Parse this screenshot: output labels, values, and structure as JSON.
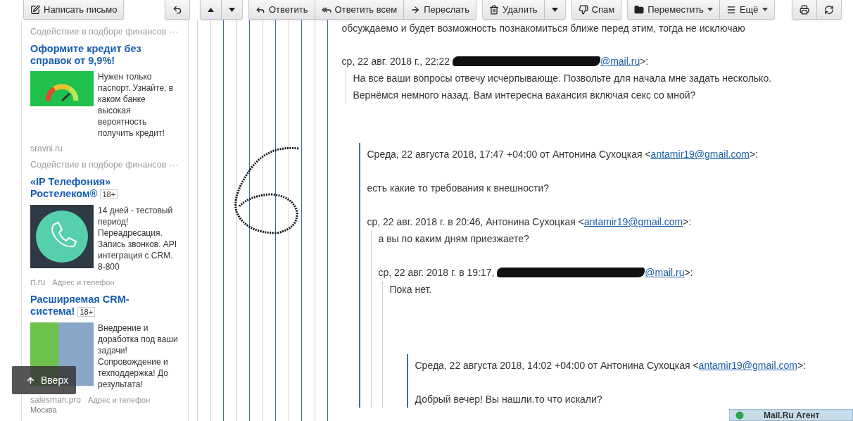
{
  "toolbar": {
    "groups": [
      [
        {
          "kind": "compose",
          "label": "Написать письмо"
        }
      ],
      [
        {
          "kind": "undo"
        }
      ],
      [
        {
          "kind": "up"
        },
        {
          "kind": "down"
        }
      ],
      [
        {
          "kind": "reply",
          "label": "Ответить"
        },
        {
          "kind": "reply-all",
          "label": "Ответить всем"
        },
        {
          "kind": "forward",
          "label": "Переслать"
        }
      ],
      [
        {
          "kind": "delete",
          "label": "Удалить"
        },
        {
          "kind": "caret"
        }
      ],
      [
        {
          "kind": "spam",
          "label": "Спам"
        }
      ],
      [
        {
          "kind": "move",
          "label": "Переместить",
          "dropdown": true
        },
        {
          "kind": "more",
          "label": "Ещё",
          "dropdown": true
        }
      ],
      [
        {
          "kind": "print"
        },
        {
          "kind": "refresh"
        }
      ]
    ]
  },
  "sidebar": {
    "ads": [
      {
        "category": "Содействие в подборе финансов",
        "title": "Оформите кредит без справок от 9,9%!",
        "text": "Нужен только паспорт. Узнайте, в каком банке высокая вероятность получить кредит!",
        "domain": "sravni.ru"
      },
      {
        "category": "Содействие в подборе финансов",
        "title": "«IP Телефония» Ростелеком®",
        "badge": "18+",
        "text": "14 дней - тестовый период! Переадресация. Запись звонков. API интеграция с CRM. 8-800",
        "domain": "rt.ru",
        "address_link": "Адрес и телефон"
      },
      {
        "title": "Расширяемая CRM-система!",
        "badge": "18+",
        "text": "Внедрение и доработка под ваши задачи! Сопровождение и техподдержка! До результата!",
        "domain": "salesman.pro",
        "address_link": "Адрес и телефон",
        "city": "Москва"
      }
    ],
    "more_marker": "···",
    "scroll_top_button": "Вверх"
  },
  "letter": {
    "earlier_text": "обсуждаемо и будет возможность познакомиться ближе перед этим, тогда не исключаю",
    "messages": [
      {
        "kind": "gmail",
        "header": "ср, 22 авг. 2018 г., 22:22 ",
        "redacted": true,
        "email": "@mail.ru",
        "tail": ">:",
        "body": [
          "На все ваши вопросы отвечу исчерпывающе. Позвольте для начала мне задать несколько.",
          "Вернёмся немного назад. Вам интересна вакансия включая секс со мной?"
        ]
      },
      {
        "kind": "mailru",
        "header": "Среда, 22 августа 2018, 17:47 +04:00 от Антонина Сухоцкая <",
        "redacted": false,
        "email": "antamir19@gmail.com",
        "tail": ">:",
        "body": [
          "есть какие то требования к внешности?"
        ],
        "children": [
          {
            "kind": "gmail",
            "header": "ср, 22 авг. 2018 г. в 20:46, Антонина Сухоцкая <",
            "redacted": false,
            "email": "antamir19@gmail.com",
            "tail": ">:",
            "body": [
              "а вы по каким дням приезжаете?"
            ],
            "children": [
              {
                "kind": "gmail",
                "header": "ср, 22 авг. 2018 г. в 19:17, ",
                "redacted": true,
                "email": "@mail.ru",
                "tail": ">:",
                "body": [
                  "Пока нет."
                ],
                "children": [
                  {
                    "kind": "mailru",
                    "header": "Среда, 22 августа 2018, 14:02 +04:00 от Антонина Сухоцкая <",
                    "redacted": false,
                    "email": "antamir19@gmail.com",
                    "tail": ">:",
                    "body": [
                      "Добрый вечер! Вы нашли.то что искали?"
                    ]
                  }
                ]
              }
            ]
          }
        ]
      }
    ]
  },
  "agent_bar": {
    "label": "Mail.Ru Агент"
  }
}
